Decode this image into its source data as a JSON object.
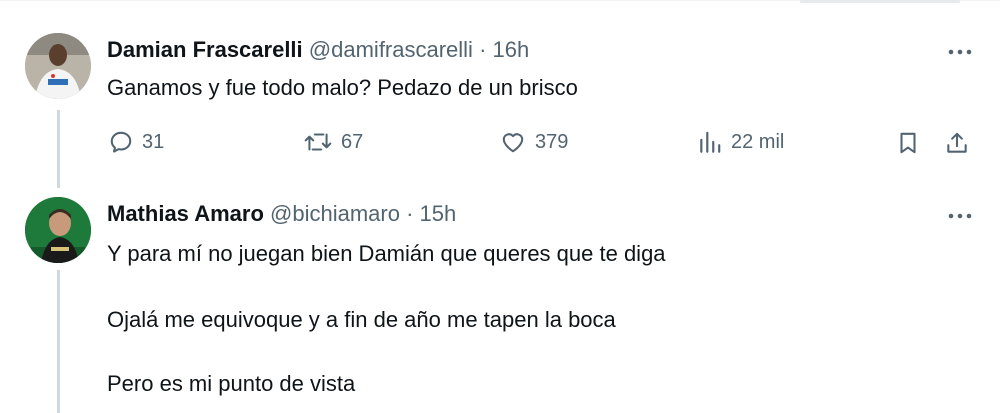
{
  "tweets": [
    {
      "author_name": "Damian Frascarelli",
      "handle": "@damifrascarelli",
      "separator": "·",
      "time": "16h",
      "text": "Ganamos y fue todo malo? Pedazo de un brisco",
      "stats": {
        "replies": "31",
        "reposts": "67",
        "likes": "379",
        "views": "22 mil"
      }
    },
    {
      "author_name": "Mathias Amaro",
      "handle": "@bichiamaro",
      "separator": "·",
      "time": "15h",
      "lines": [
        "Y para mí no juegan bien Damián que queres que te diga",
        "Ojalá me equivoque y a fin de año me tapen la boca",
        "Pero es mi punto de vista"
      ]
    }
  ],
  "icons": {
    "reply": "reply-icon",
    "repost": "repost-icon",
    "like": "heart-icon",
    "views": "views-icon",
    "bookmark": "bookmark-icon",
    "share": "share-icon",
    "more": "more-icon"
  },
  "colors": {
    "text": "#0f1419",
    "secondary": "#536471",
    "thread_line": "#cfd9de"
  }
}
